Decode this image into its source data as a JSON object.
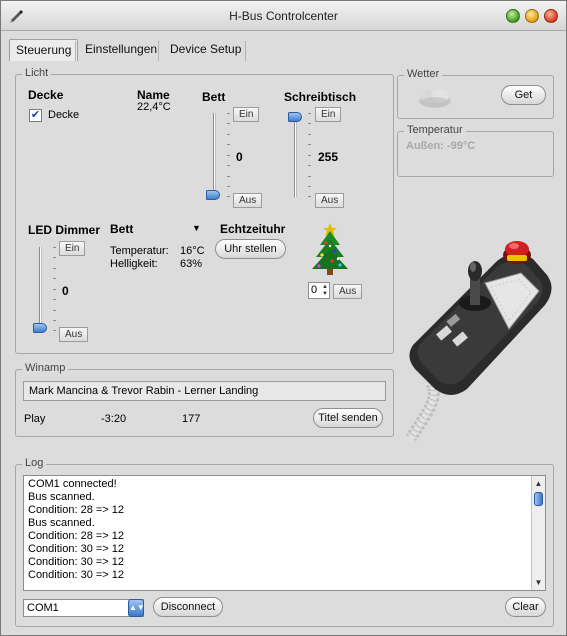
{
  "window": {
    "title": "H-Bus Controlcenter"
  },
  "tabs": [
    {
      "label": "Steuerung",
      "active": true
    },
    {
      "label": "Einstellungen",
      "active": false
    },
    {
      "label": "Device Setup",
      "active": false
    }
  ],
  "licht": {
    "group_label": "Licht",
    "decke": {
      "heading": "Decke",
      "checkbox_label": "Decke",
      "checked": true
    },
    "name": {
      "heading": "Name",
      "value": "22,4°C"
    },
    "bett": {
      "heading": "Bett",
      "ein": "Ein",
      "aus": "Aus",
      "value": "0"
    },
    "schreibtisch": {
      "heading": "Schreibtisch",
      "ein": "Ein",
      "aus": "Aus",
      "value": "255"
    },
    "led_dimmer": {
      "heading": "LED Dimmer",
      "ein": "Ein",
      "aus": "Aus",
      "value": "0"
    },
    "sensor": {
      "selected": "Bett",
      "temp_label": "Temperatur:",
      "temp_value": "16°C",
      "hell_label": "Helligkeit:",
      "hell_value": "63%"
    },
    "echtzeituhr": {
      "heading": "Echtzeituhr",
      "button": "Uhr stellen"
    },
    "tree": {
      "spinner_value": "0",
      "aus": "Aus"
    }
  },
  "wetter": {
    "group_label": "Wetter",
    "get_button": "Get",
    "icon": "cloud-icon"
  },
  "temperatur": {
    "group_label": "Temperatur",
    "text": "Außen: -99°C"
  },
  "winamp": {
    "group_label": "Winamp",
    "track": "Mark Mancina & Trevor Rabin - Lerner Landing",
    "status": "Play",
    "time": "-3:20",
    "number": "177",
    "send_button": "Titel senden"
  },
  "log": {
    "group_label": "Log",
    "lines": [
      "COM1 connected!",
      "Bus scanned.",
      "Condition: 28 => 12",
      "Bus scanned.",
      "Condition: 28 => 12",
      "Condition: 30 => 12",
      "Condition: 30 => 12",
      "Condition: 30 => 12"
    ],
    "port": "COM1",
    "disconnect_button": "Disconnect",
    "clear_button": "Clear"
  },
  "colors": {
    "accent": "#3d7fd1",
    "window_bg": "#dcdcdc"
  }
}
